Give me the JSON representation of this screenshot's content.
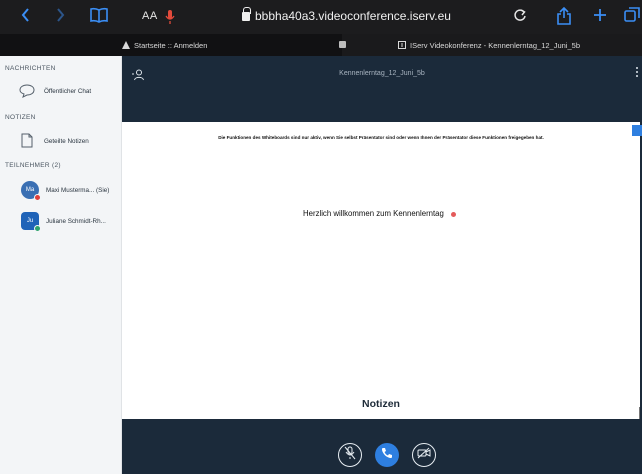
{
  "browser": {
    "text_size_label": "AA",
    "url": "bbbha40a3.videoconference.iserv.eu",
    "tabs": [
      {
        "label": "Startseite :: Anmelden"
      },
      {
        "label": "IServ Videokonferenz - Kennenlerntag_12_Juni_5b"
      }
    ]
  },
  "sidebar": {
    "messages_header": "NACHRICHTEN",
    "public_chat": "Öffentlicher Chat",
    "notes_header": "NOTIZEN",
    "shared_notes": "Geteilte Notizen",
    "participants_header": "TEILNEHMER (2)",
    "participants": [
      {
        "initials": "Ma",
        "name": "Maxi Musterma... (Sie)"
      },
      {
        "initials": "Ju",
        "name": "Juliane Schmidt-Rh..."
      }
    ]
  },
  "meeting": {
    "title": "Kennenlerntag_12_Juni_5b"
  },
  "whiteboard": {
    "notice": "Die Funktionen des Whiteboards sind nur aktiv, wenn Sie selbst Präsentator sind oder wenn Ihnen der Präsentator diese Funktionen freigegeben hat.",
    "welcome_text": "Herzlich willkommen zum Kennenlerntag",
    "notes_title": "Notizen"
  },
  "colors": {
    "browser_accent": "#3b8ef5",
    "dark_bg": "#1b2a3a",
    "primary_blue": "#2e7fe0",
    "avatar_maxi": "#3a6fb3",
    "avatar_juliane": "#1f63b8",
    "badge_red": "#e0403a",
    "badge_green": "#2fa36b",
    "mic_red": "#e24a3b"
  },
  "icons": {
    "back": "chevron-left-icon",
    "forward": "chevron-right-icon",
    "bookmarks": "book-icon",
    "reload": "reload-icon",
    "share": "share-icon",
    "new_tab": "plus-icon",
    "tabs": "tabs-icon",
    "chat": "chat-bubble-icon",
    "notes": "document-icon",
    "user_toggle": "users-icon",
    "mic_muted": "mic-off-icon",
    "phone": "phone-icon",
    "camera_off": "camera-off-icon"
  }
}
